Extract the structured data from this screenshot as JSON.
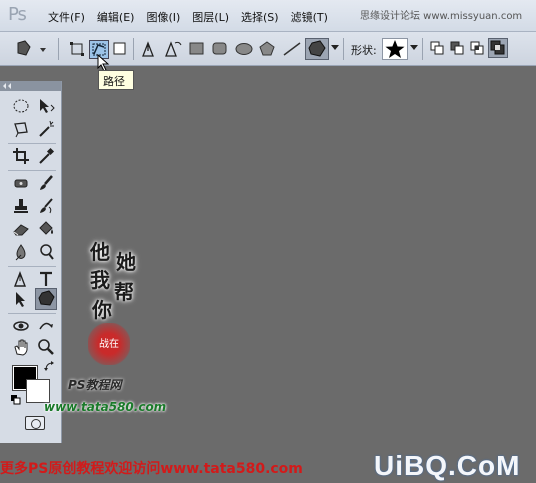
{
  "app": {
    "logo": "Ps"
  },
  "menu": {
    "items": [
      "文件(F)",
      "编辑(E)",
      "图像(I)",
      "图层(L)",
      "选择(S)",
      "滤镜(T)"
    ],
    "watermark": "思缘设计论坛 www.missyuan.com"
  },
  "options_bar": {
    "shape_label": "形状:",
    "tooltip": "路径"
  },
  "overlay": {
    "calligraphy": [
      "他",
      "她",
      "我",
      "帮",
      "你"
    ],
    "seal": "战在",
    "tutorial": "PS教程网",
    "url": "www.tata580.com"
  },
  "footer": {
    "banner": "更多PS原创教程欢迎访问www.tata580.com",
    "site_logo": "UiBQ.CoM"
  },
  "colors": {
    "foreground": "#000000",
    "background": "#ffffff",
    "canvas": "#6b6b6b"
  }
}
